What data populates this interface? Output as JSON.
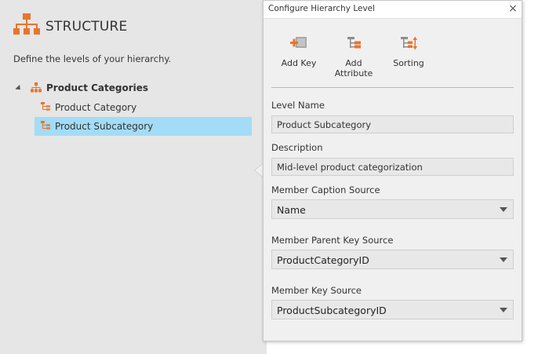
{
  "structure": {
    "title": "STRUCTURE",
    "description": "Define the levels of your hierarchy.",
    "tree": {
      "root_label": "Product Categories",
      "items": [
        {
          "label": "Product Category",
          "selected": false
        },
        {
          "label": "Product Subcategory",
          "selected": true
        }
      ]
    }
  },
  "dialog": {
    "title": "Configure Hierarchy Level",
    "close_glyph": "×",
    "toolbar": {
      "add_key": "Add Key",
      "add_attribute_line1": "Add",
      "add_attribute_line2": "Attribute",
      "sorting": "Sorting"
    },
    "level_name": {
      "label": "Level Name",
      "value": "Product Subcategory"
    },
    "description": {
      "label": "Description",
      "value": "Mid-level product categorization"
    },
    "member_caption_source": {
      "label": "Member Caption Source",
      "value": "Name"
    },
    "member_parent_key_source": {
      "label": "Member Parent Key Source",
      "value": "ProductCategoryID"
    },
    "member_key_source": {
      "label": "Member Key Source",
      "value": "ProductSubcategoryID"
    }
  },
  "colors": {
    "accent_orange": "#e8752c",
    "selection_blue": "#a3dcf6",
    "panel_gray": "#e6e6e6",
    "dialog_gray": "#f0f0f0"
  },
  "icons": {
    "structure": "hierarchy-icon",
    "root": "hierarchy-icon",
    "level": "level-icon",
    "add_key": "add-key-icon",
    "add_attribute": "add-attribute-icon",
    "sorting": "sorting-icon",
    "close": "close-icon"
  }
}
